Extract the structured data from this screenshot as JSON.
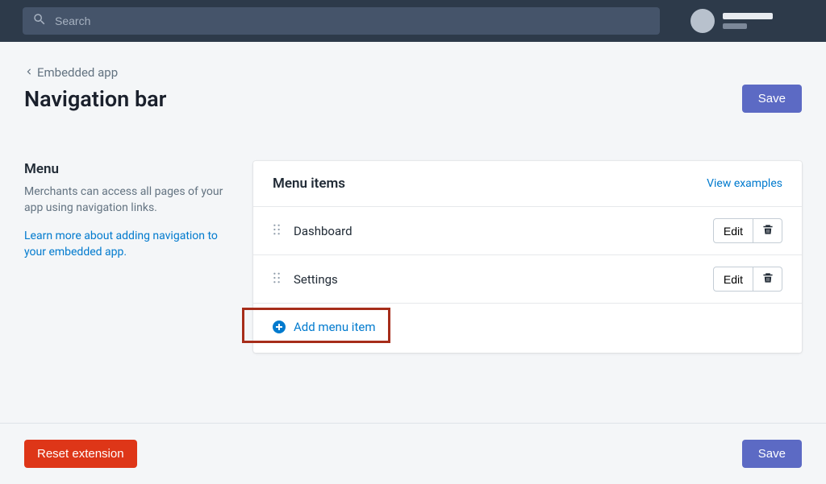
{
  "topbar": {
    "search_placeholder": "Search"
  },
  "back_link": "Embedded app",
  "page_title": "Navigation bar",
  "save_label": "Save",
  "side": {
    "title": "Menu",
    "description": "Merchants can access all pages of your app using navigation links.",
    "learn_more": "Learn more about adding navigation to your embedded app."
  },
  "card": {
    "title": "Menu items",
    "view_examples": "View examples",
    "items": [
      {
        "label": "Dashboard"
      },
      {
        "label": "Settings"
      }
    ],
    "edit_label": "Edit",
    "add_label": "Add menu item"
  },
  "footer": {
    "reset_label": "Reset extension",
    "save_label": "Save"
  }
}
